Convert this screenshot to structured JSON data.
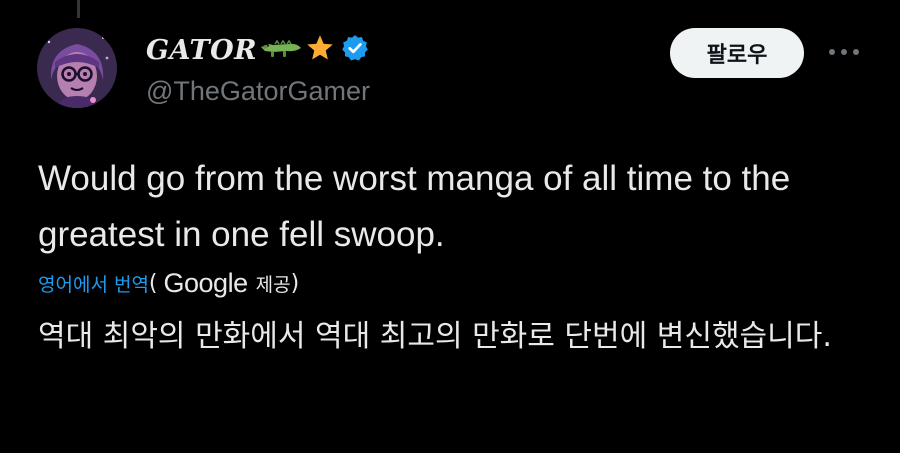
{
  "tweet": {
    "author": {
      "display_name": "GATOR",
      "handle": "@TheGatorGamer",
      "name_emojis": [
        "crocodile-icon",
        "star-icon",
        "verified-badge-icon"
      ]
    },
    "follow_label": "팔로우",
    "more_icon": "more-horizontal-icon",
    "text": "Would go from the worst manga of all time to the greatest in one fell swoop.",
    "translation": {
      "label": "영어에서 번역",
      "paren_open": "(",
      "provider": "Google",
      "provider_suffix": "제공",
      "paren_close": ")",
      "text": "역대 최악의 만화에서 역대 최고의 만화로 단번에 변신했습니다."
    }
  },
  "colors": {
    "background": "#000000",
    "primary_text": "#e7e9ea",
    "secondary_text": "#71767b",
    "link": "#1d9bf0",
    "verified": "#1d9bf0",
    "star": "#ffac33",
    "crocodile": "#77b255",
    "follow_bg": "#eff3f4"
  }
}
